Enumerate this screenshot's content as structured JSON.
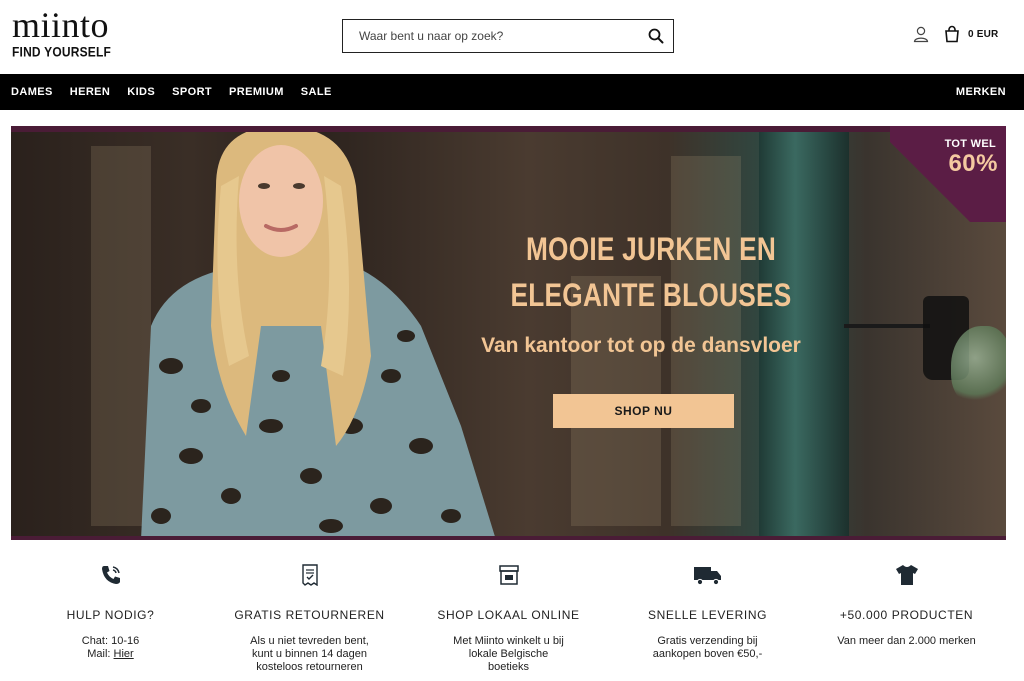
{
  "brand": {
    "name": "miinto",
    "tagline": "FIND YOURSELF"
  },
  "search": {
    "placeholder": "Waar bent u naar op zoek?"
  },
  "cart": {
    "label": "0 EUR"
  },
  "nav": {
    "items": [
      "DAMES",
      "HEREN",
      "KIDS",
      "SPORT",
      "PREMIUM",
      "SALE"
    ],
    "brands": "MERKEN"
  },
  "hero": {
    "badge_top": "TOT WEL",
    "badge_value": "60%",
    "title_line1": "MOOIE JURKEN EN",
    "title_line2": "ELEGANTE BLOUSES",
    "subtitle": "Van kantoor tot op de dansvloer",
    "cta": "SHOP NU"
  },
  "usps": [
    {
      "icon": "phone-icon",
      "title": "HULP NODIG?",
      "line1": "Chat: 10-16",
      "line2_prefix": "Mail: ",
      "line2_link": "Hier"
    },
    {
      "icon": "receipt-icon",
      "title": "GRATIS RETOURNEREN",
      "text": "Als u niet tevreden bent, kunt u binnen 14 dagen kosteloos retourneren"
    },
    {
      "icon": "store-icon",
      "title": "SHOP LOKAAL ONLINE",
      "text": "Met Miinto winkelt u bij lokale Belgische boetieks"
    },
    {
      "icon": "truck-icon",
      "title": "SNELLE LEVERING",
      "text": "Gratis verzending bij aankopen boven €50,-"
    },
    {
      "icon": "tshirt-icon",
      "title": "+50.000 PRODUCTEN",
      "text": "Van meer dan 2.000 merken"
    }
  ],
  "colors": {
    "accent": "#f2c594",
    "badge": "#5b1d45",
    "nav_bg": "#000000"
  }
}
